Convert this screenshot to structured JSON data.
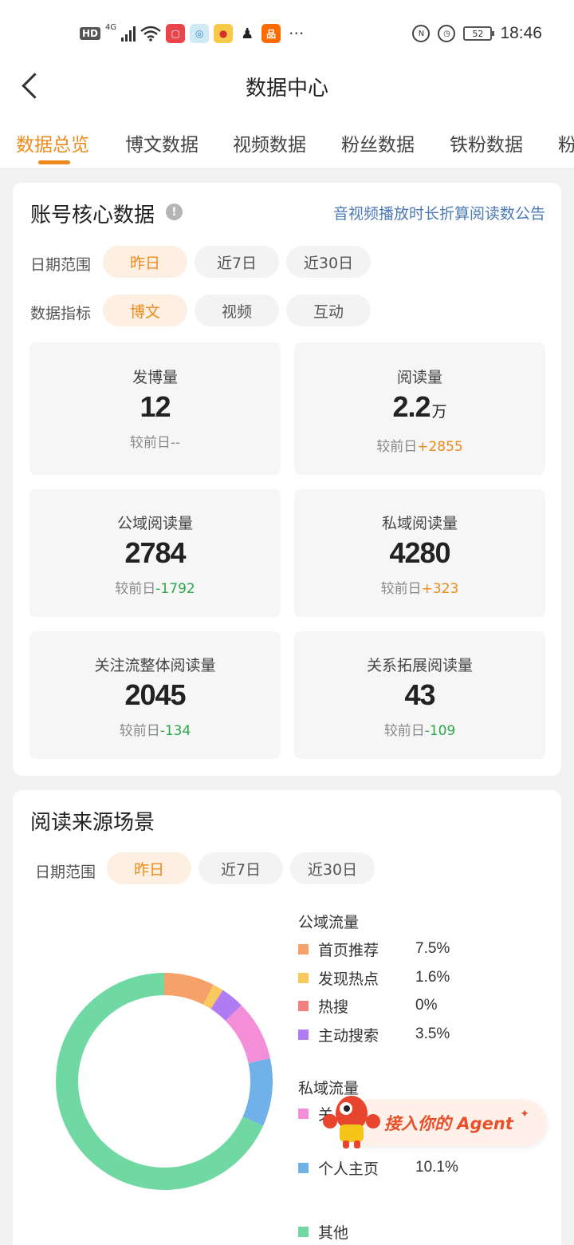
{
  "status_bar": {
    "hd": "HD",
    "network": "4G",
    "battery": "52",
    "time": "18:46",
    "icons": [
      "hd-icon",
      "signal-icon",
      "wifi-icon",
      "huawei-store-icon",
      "app-icon",
      "weibo-icon",
      "qq-icon",
      "taobao-icon",
      "more-icon",
      "nfc-icon",
      "alarm-icon",
      "battery-icon"
    ]
  },
  "header": {
    "title": "数据中心"
  },
  "tabs": [
    {
      "label": "数据总览",
      "active": true
    },
    {
      "label": "博文数据"
    },
    {
      "label": "视频数据"
    },
    {
      "label": "粉丝数据"
    },
    {
      "label": "铁粉数据"
    },
    {
      "label": "粉"
    }
  ],
  "core": {
    "title": "账号核心数据",
    "notice": "音视频播放时长折算阅读数公告",
    "date_label": "日期范围",
    "date_options": [
      "昨日",
      "近7日",
      "近30日"
    ],
    "metric_label": "数据指标",
    "metric_options": [
      "博文",
      "视频",
      "互动"
    ],
    "stats": [
      {
        "label": "发博量",
        "value": "12",
        "unit": "",
        "cmp_label": "较前日",
        "cmp": "--",
        "trend": "none"
      },
      {
        "label": "阅读量",
        "value": "2.2",
        "unit": "万",
        "cmp_label": "较前日",
        "cmp": "+2855",
        "trend": "up"
      },
      {
        "label": "公域阅读量",
        "value": "2784",
        "unit": "",
        "cmp_label": "较前日",
        "cmp": "-1792",
        "trend": "down"
      },
      {
        "label": "私域阅读量",
        "value": "4280",
        "unit": "",
        "cmp_label": "较前日",
        "cmp": "+323",
        "trend": "up"
      },
      {
        "label": "关注流整体阅读量",
        "value": "2045",
        "unit": "",
        "cmp_label": "较前日",
        "cmp": "-134",
        "trend": "down"
      },
      {
        "label": "关系拓展阅读量",
        "value": "43",
        "unit": "",
        "cmp_label": "较前日",
        "cmp": "-109",
        "trend": "down"
      }
    ]
  },
  "source": {
    "title": "阅读来源场景",
    "date_label": "日期范围",
    "date_options": [
      "昨日",
      "近7日",
      "近30日"
    ],
    "public_label": "公域流量",
    "private_label": "私域流量"
  },
  "chart_data": {
    "type": "pie",
    "donut": true,
    "groups": [
      "公域流量",
      "私域流量"
    ],
    "series": [
      {
        "name": "首页推荐",
        "value": 7.5,
        "value_label": "7.5%",
        "color": "#f6a06a"
      },
      {
        "name": "发现热点",
        "value": 1.6,
        "value_label": "1.6%",
        "color": "#f8c95e"
      },
      {
        "name": "热搜",
        "value": 0,
        "value_label": "0%",
        "color": "#f38080"
      },
      {
        "name": "主动搜索",
        "value": 3.5,
        "value_label": "3.5%",
        "color": "#b07cf3"
      },
      {
        "name": "关",
        "value": 9.0,
        "value_label": "",
        "color": "#f48ed8"
      },
      {
        "name": "个人主页",
        "value": 10.1,
        "value_label": "10.1%",
        "color": "#6fb1e8"
      },
      {
        "name": "其他",
        "value": 68.3,
        "value_label": "",
        "color": "#6fd8a3"
      }
    ]
  },
  "agent_button": {
    "label": "接入你的 Agent"
  }
}
